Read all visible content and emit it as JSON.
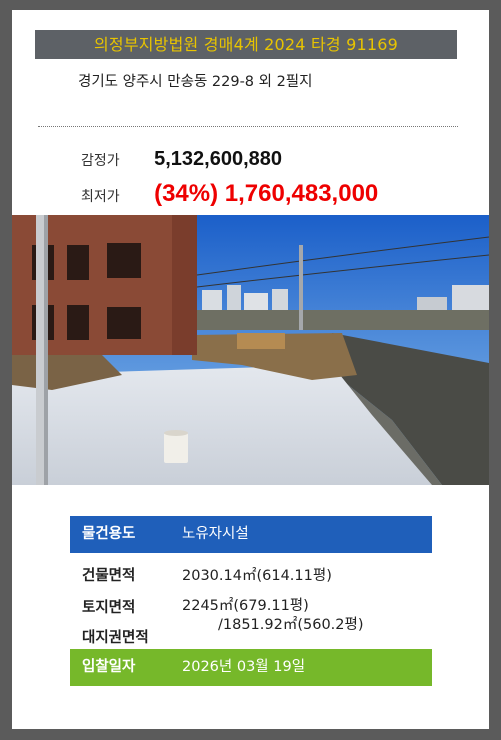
{
  "header": {
    "title": "의정부지방법원 경매4계 2024 타경 91169",
    "address": "경기도 양주시 만송동 229-8 외 2필지"
  },
  "prices": {
    "appraised_label": "감정가",
    "appraised_value": "5,132,600,880",
    "minimum_label": "최저가",
    "minimum_value": "(34%) 1,760,483,000"
  },
  "details": {
    "use_label": "물건용도",
    "use_value": "노유자시설",
    "building_area_label": "건물면적",
    "building_area_value": "2030.14㎡(614.11평)",
    "land_area_label": "토지면적",
    "land_area_value": "2245㎡(679.11평)",
    "land_right_label": "대지권면적",
    "land_right_value": "/1851.92㎡(560.2평)",
    "bid_date_label": "입찰일자",
    "bid_date_value": "2026년 03월 19일"
  },
  "colors": {
    "background": "#5b5b5b",
    "banner": "#5d6166",
    "banner_text": "#e8c400",
    "minimum_price": "#ee0000",
    "use_row": "#1f5fba",
    "bid_row": "#76b82a"
  }
}
